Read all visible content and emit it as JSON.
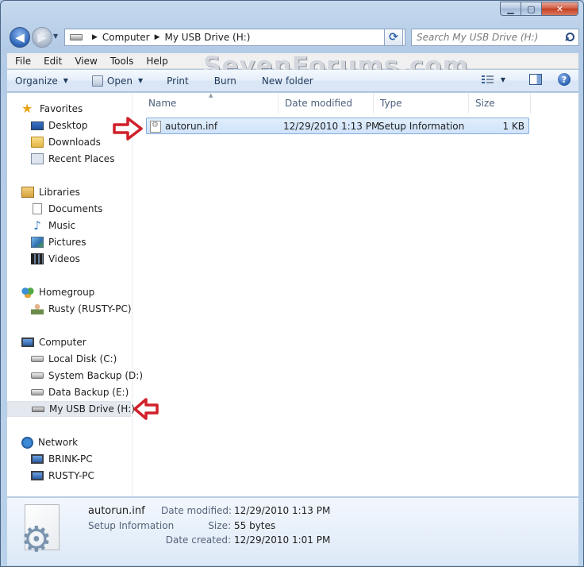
{
  "window": {
    "caption_buttons": {
      "minimize": "▁",
      "maximize": "▢",
      "close": "✕"
    }
  },
  "navbar": {
    "back_glyph": "◀",
    "forward_glyph": "▶",
    "breadcrumb": [
      "Computer",
      "My USB Drive (H:)"
    ],
    "search_placeholder": "Search My USB Drive (H:)",
    "refresh_glyph": "⟳"
  },
  "menu": {
    "items": [
      "File",
      "Edit",
      "View",
      "Tools",
      "Help"
    ]
  },
  "watermark": "SevenForums.com",
  "toolbar": {
    "organize": "Organize",
    "open": "Open",
    "print": "Print",
    "burn": "Burn",
    "new_folder": "New folder",
    "help_glyph": "?"
  },
  "nav_pane": {
    "favorites": {
      "label": "Favorites",
      "items": [
        "Desktop",
        "Downloads",
        "Recent Places"
      ]
    },
    "libraries": {
      "label": "Libraries",
      "items": [
        "Documents",
        "Music",
        "Pictures",
        "Videos"
      ]
    },
    "homegroup": {
      "label": "Homegroup",
      "items": [
        "Rusty (RUSTY-PC)"
      ]
    },
    "computer": {
      "label": "Computer",
      "items": [
        "Local Disk (C:)",
        "System Backup (D:)",
        "Data Backup (E:)",
        "My USB Drive (H:)"
      ]
    },
    "network": {
      "label": "Network",
      "items": [
        "BRINK-PC",
        "RUSTY-PC"
      ]
    }
  },
  "file_list": {
    "columns": [
      "Name",
      "Date modified",
      "Type",
      "Size"
    ],
    "rows": [
      {
        "name": "autorun.inf",
        "date_modified": "12/29/2010 1:13 PM",
        "type": "Setup Information",
        "size": "1 KB"
      }
    ]
  },
  "details_pane": {
    "name": "autorun.inf",
    "type": "Setup Information",
    "date_modified_label": "Date modified:",
    "date_modified": "12/29/2010 1:13 PM",
    "size_label": "Size:",
    "size": "55 bytes",
    "date_created_label": "Date created:",
    "date_created": "12/29/2010 1:01 PM"
  },
  "colors": {
    "annotation_arrow": "#d0202a",
    "selection": "#cfe3fb",
    "frame": "#b9d1ea"
  }
}
